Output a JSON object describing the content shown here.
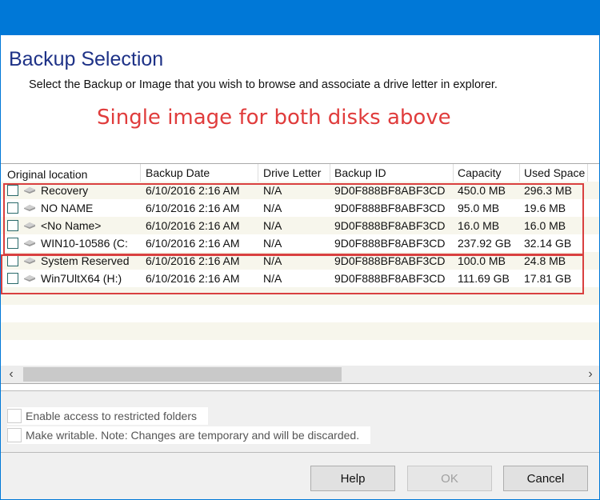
{
  "dialog": {
    "title": "Backup Selection",
    "subtitle": "Select the Backup or Image that you wish to browse and associate a drive letter in explorer.",
    "annotation": "Single image for both disks above",
    "accent_color": "#0078d7",
    "annotation_color": "#e03c3c"
  },
  "table": {
    "columns": [
      "Original location",
      "Backup Date",
      "Drive Letter",
      "Backup ID",
      "Capacity",
      "Used Space"
    ],
    "rows": [
      {
        "location": "Recovery",
        "date": "6/10/2016 2:16 AM",
        "drive": "N/A",
        "id": "9D0F888BF8ABF3CD",
        "capacity": "450.0 MB",
        "used": "296.3 MB",
        "checked": false
      },
      {
        "location": "NO NAME",
        "date": "6/10/2016 2:16 AM",
        "drive": "N/A",
        "id": "9D0F888BF8ABF3CD",
        "capacity": "95.0 MB",
        "used": "19.6 MB",
        "checked": false
      },
      {
        "location": "<No Name>",
        "date": "6/10/2016 2:16 AM",
        "drive": "N/A",
        "id": "9D0F888BF8ABF3CD",
        "capacity": "16.0 MB",
        "used": "16.0 MB",
        "checked": false
      },
      {
        "location": "WIN10-10586 (C:",
        "date": "6/10/2016 2:16 AM",
        "drive": "N/A",
        "id": "9D0F888BF8ABF3CD",
        "capacity": "237.92 GB",
        "used": "32.14 GB",
        "checked": false
      },
      {
        "location": "System Reserved",
        "date": "6/10/2016 2:16 AM",
        "drive": "N/A",
        "id": "9D0F888BF8ABF3CD",
        "capacity": "100.0 MB",
        "used": "24.8 MB",
        "checked": false
      },
      {
        "location": "Win7UltX64 (H:)",
        "date": "6/10/2016 2:16 AM",
        "drive": "N/A",
        "id": "9D0F888BF8ABF3CD",
        "capacity": "111.69 GB",
        "used": "17.81 GB",
        "checked": false
      }
    ],
    "scroll": {
      "left_icon": "chevron-left-icon",
      "right_icon": "chevron-right-icon"
    }
  },
  "options": {
    "restricted_label": "Enable access to restricted folders",
    "restricted_checked": false,
    "writable_label": "Make writable. Note: Changes are temporary and will be discarded.",
    "writable_checked": false
  },
  "buttons": {
    "help": "Help",
    "ok": "OK",
    "ok_enabled": false,
    "cancel": "Cancel"
  }
}
